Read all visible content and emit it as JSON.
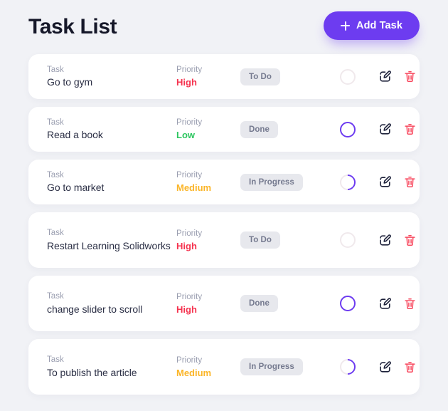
{
  "header": {
    "title": "Task List",
    "add_button_label": "Add Task",
    "add_button_icon": "plus-icon",
    "accent_color": "#6d3cf0"
  },
  "columns": {
    "task_label": "Task",
    "priority_label": "Priority"
  },
  "colors": {
    "background": "#f1f2f6",
    "card": "#ffffff",
    "title": "#161829",
    "accent": "#6d3cf0",
    "priority_high": "#f5334f",
    "priority_medium": "#fbb528",
    "priority_low": "#2cc65f",
    "badge_bg": "#e7e8ed",
    "badge_text": "#757a8f",
    "trash": "#f8485e",
    "edit": "#1c2039",
    "ring_empty": "#f0e9ec"
  },
  "actions": {
    "edit_icon": "edit-pencil-icon",
    "delete_icon": "trash-icon"
  },
  "tasks": [
    {
      "task_label": "Task",
      "name": "Go to gym",
      "priority_label": "Priority",
      "priority": "High",
      "status": "To Do",
      "progress_state": "empty"
    },
    {
      "task_label": "Task",
      "name": "Read a book",
      "priority_label": "Priority",
      "priority": "Low",
      "status": "Done",
      "progress_state": "done"
    },
    {
      "task_label": "Task",
      "name": "Go to market",
      "priority_label": "Priority",
      "priority": "Medium",
      "status": "In Progress",
      "progress_state": "half"
    },
    {
      "task_label": "Task",
      "name": "Restart Learning Solidworks",
      "priority_label": "Priority",
      "priority": "High",
      "status": "To Do",
      "progress_state": "empty"
    },
    {
      "task_label": "Task",
      "name": "change slider to scroll",
      "priority_label": "Priority",
      "priority": "High",
      "status": "Done",
      "progress_state": "done"
    },
    {
      "task_label": "Task",
      "name": "To publish the article",
      "priority_label": "Priority",
      "priority": "Medium",
      "status": "In Progress",
      "progress_state": "half"
    }
  ]
}
